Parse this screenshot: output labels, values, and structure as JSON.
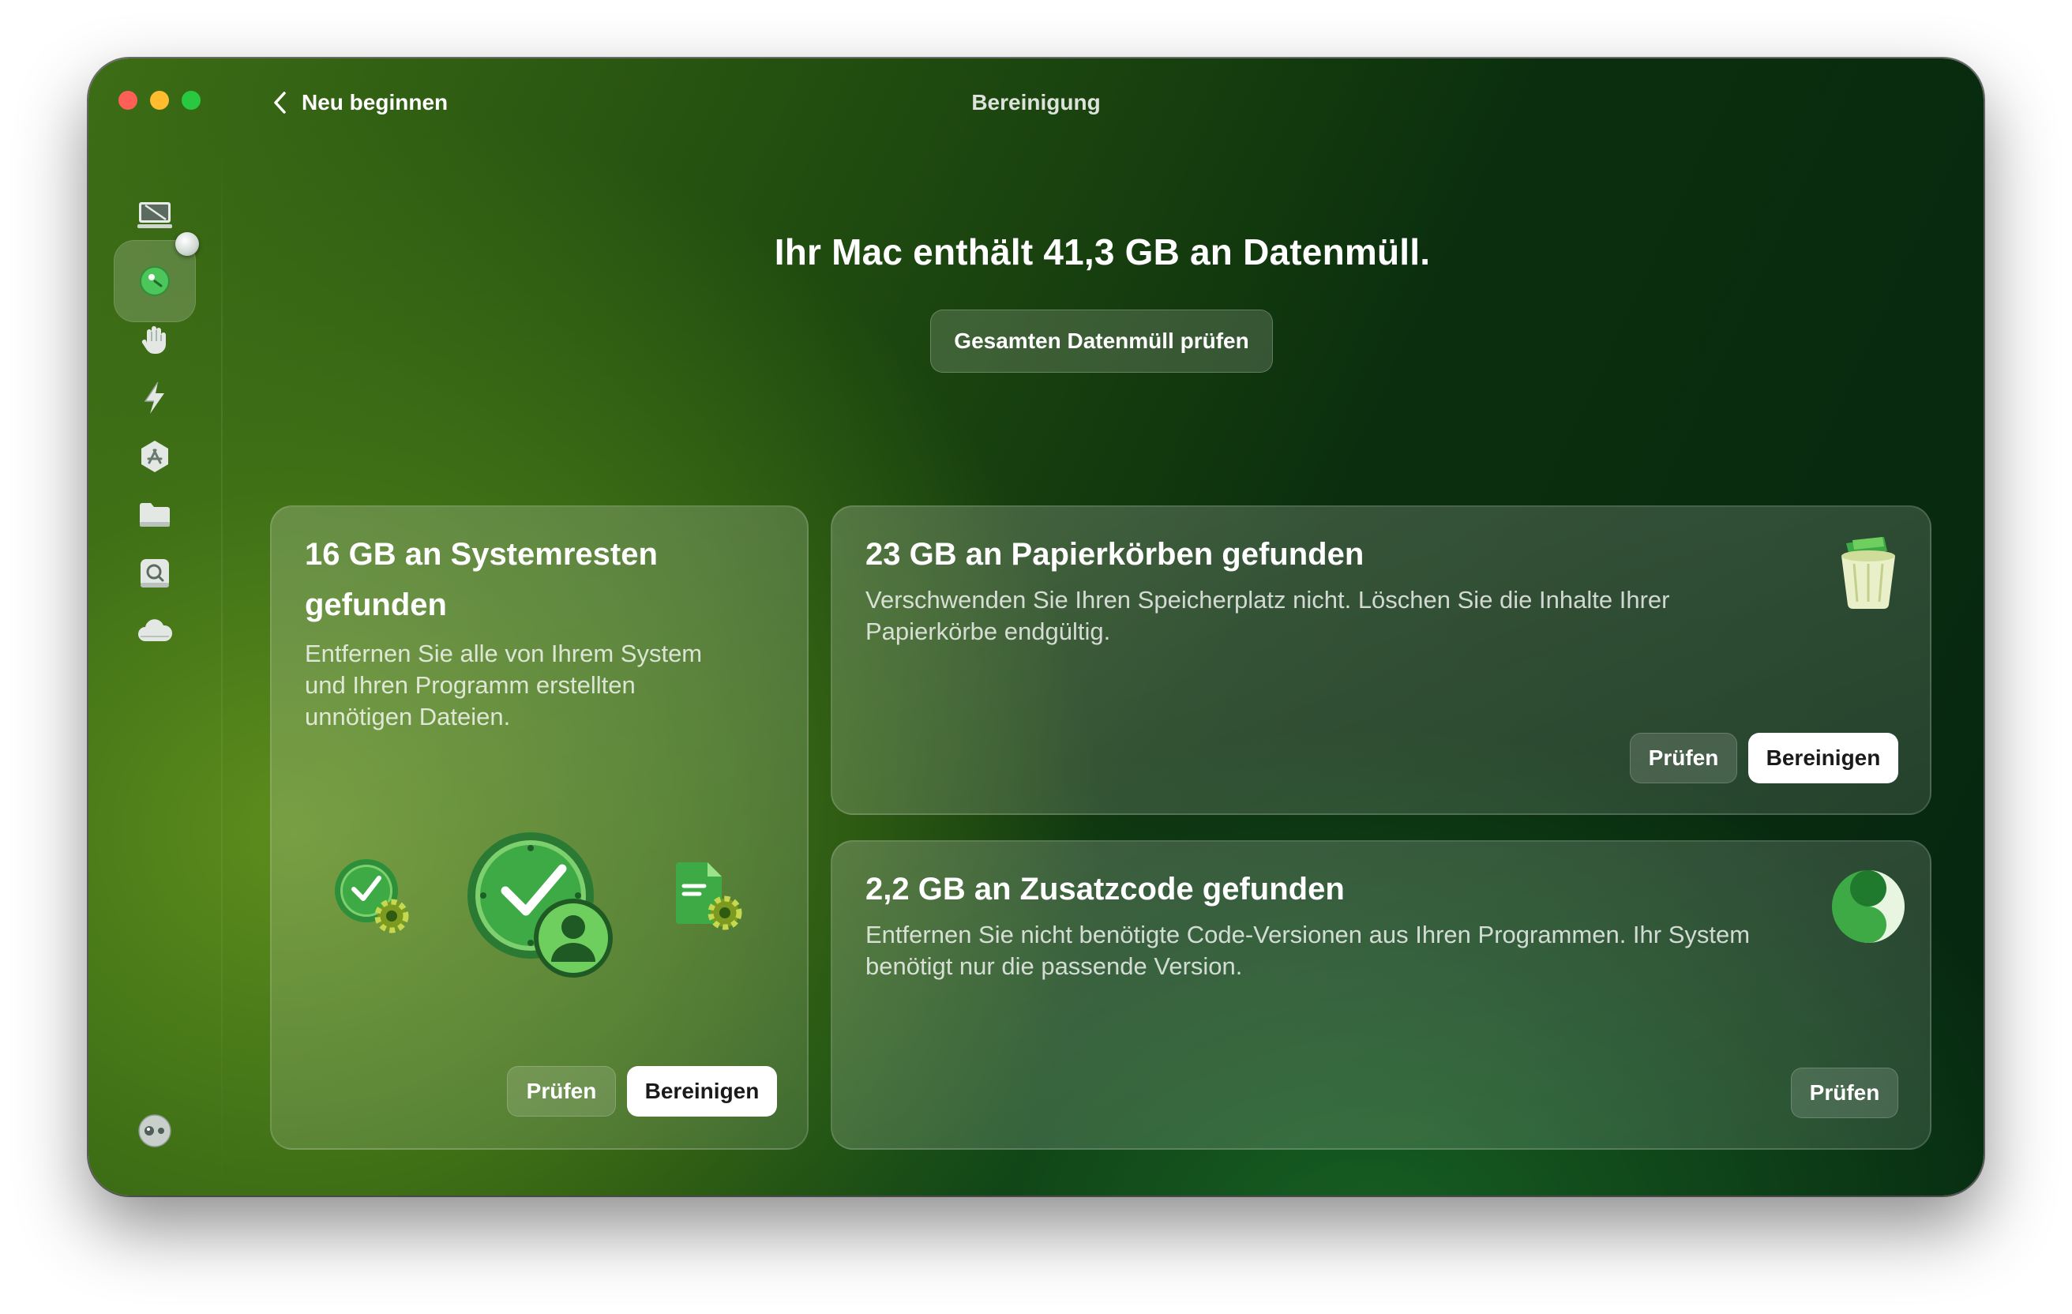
{
  "window": {
    "title": "Bereinigung",
    "back_label": "Neu beginnen"
  },
  "sidebar": {
    "items": [
      {
        "name": "smart-scan",
        "icon": "monitor-icon"
      },
      {
        "name": "cleanup",
        "icon": "cleanup-icon",
        "active": true
      },
      {
        "name": "protection",
        "icon": "hand-icon"
      },
      {
        "name": "performance",
        "icon": "lightning-icon"
      },
      {
        "name": "applications",
        "icon": "app-store-icon"
      },
      {
        "name": "my-clutter",
        "icon": "folder-icon"
      },
      {
        "name": "space-lens",
        "icon": "disk-search-icon"
      },
      {
        "name": "cloud-cleanup",
        "icon": "cloud-icon"
      },
      {
        "name": "assistant",
        "icon": "assistant-icon"
      }
    ]
  },
  "main": {
    "headline": "Ihr Mac enthält 41,3 GB an Datenmüll.",
    "review_all_label": "Gesamten Datenmüll prüfen"
  },
  "cards": {
    "system_junk": {
      "title_line1": "16 GB an Systemresten",
      "title_line2": "gefunden",
      "desc_line1": "Entfernen Sie alle von Ihrem System",
      "desc_line2": "und Ihren Programm erstellten",
      "desc_line3": "unnötigen Dateien.",
      "review_label": "Prüfen",
      "clean_label": "Bereinigen"
    },
    "trash": {
      "title": "23 GB an Papierkörben gefunden",
      "desc_line1": "Verschwenden Sie Ihren Speicherplatz nicht. Löschen Sie die Inhalte Ihrer",
      "desc_line2": "Papierkörbe endgültig.",
      "review_label": "Prüfen",
      "clean_label": "Bereinigen"
    },
    "universal_binaries": {
      "title": "2,2 GB an Zusatzcode gefunden",
      "desc_line1": "Entfernen Sie nicht benötigte Code-Versionen aus Ihren Programmen. Ihr System",
      "desc_line2": "benötigt nur die passende Version.",
      "review_label": "Prüfen"
    }
  },
  "colors": {
    "accent_green": "#3fae4a",
    "close": "#fe5f57",
    "minimize": "#febc2e",
    "zoom": "#28c840"
  }
}
